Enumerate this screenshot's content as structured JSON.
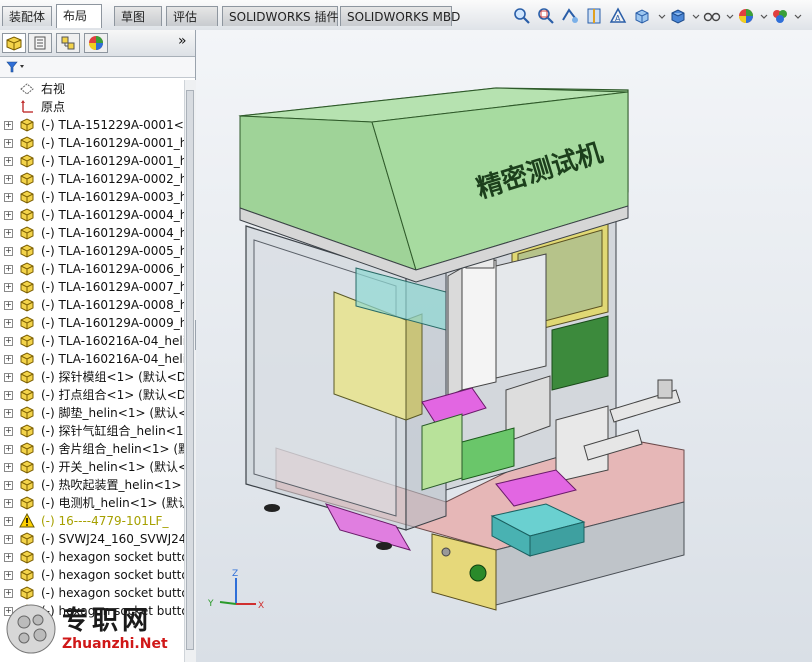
{
  "tabs": [
    "装配体",
    "布局",
    "草图",
    "评估",
    "SOLIDWORKS 插件",
    "SOLIDWORKS MBD"
  ],
  "active_tab": "布局",
  "toolbar_icons": [
    "zoom-to-fit-icon",
    "zoom-area-icon",
    "previous-view-icon",
    "section-view-icon",
    "dynamic-annotation-icon",
    "view-orientation-icon",
    "display-style-icon",
    "hide-show-items-icon",
    "edit-appearance-icon",
    "apply-scene-icon"
  ],
  "panel": {
    "tab_icons": [
      "feature-manager-icon",
      "property-manager-icon",
      "configuration-manager-icon",
      "display-manager-icon"
    ],
    "expand_symbol": "»",
    "filter_icon": "filter-icon"
  },
  "tree": [
    {
      "label": "右视",
      "icon": "plane-icon",
      "expand": false
    },
    {
      "label": "原点",
      "icon": "origin-icon",
      "expand": false
    },
    {
      "label": "(-) TLA-151229A-0001<1",
      "icon": "part-icon",
      "expand": true
    },
    {
      "label": "(-) TLA-160129A-0001_h",
      "icon": "part-icon",
      "expand": true
    },
    {
      "label": "(-) TLA-160129A-0001_h",
      "icon": "part-icon",
      "expand": true
    },
    {
      "label": "(-) TLA-160129A-0002_h",
      "icon": "part-icon",
      "expand": true
    },
    {
      "label": "(-) TLA-160129A-0003_h",
      "icon": "part-icon",
      "expand": true
    },
    {
      "label": "(-) TLA-160129A-0004_h",
      "icon": "part-icon",
      "expand": true
    },
    {
      "label": "(-) TLA-160129A-0004_h",
      "icon": "part-icon",
      "expand": true
    },
    {
      "label": "(-) TLA-160129A-0005_h",
      "icon": "part-icon",
      "expand": true
    },
    {
      "label": "(-) TLA-160129A-0006_h",
      "icon": "part-icon",
      "expand": true
    },
    {
      "label": "(-) TLA-160129A-0007_h",
      "icon": "part-icon",
      "expand": true
    },
    {
      "label": "(-) TLA-160129A-0008_h",
      "icon": "part-icon",
      "expand": true
    },
    {
      "label": "(-) TLA-160129A-0009_h",
      "icon": "part-icon",
      "expand": true
    },
    {
      "label": "(-) TLA-160216A-04_helin",
      "icon": "part-icon",
      "expand": true
    },
    {
      "label": "(-) TLA-160216A-04_helin",
      "icon": "part-icon",
      "expand": true
    },
    {
      "label": "(-) 探针模组<1> (默认<D",
      "icon": "part-icon",
      "expand": true
    },
    {
      "label": "(-) 打点组合<1> (默认<D",
      "icon": "part-icon",
      "expand": true
    },
    {
      "label": "(-) 脚垫_helin<1> (默认<",
      "icon": "part-icon",
      "expand": true
    },
    {
      "label": "(-) 探针气缸组合_helin<1",
      "icon": "part-icon",
      "expand": true
    },
    {
      "label": "(-) 舍片组合_helin<1> (默",
      "icon": "part-icon",
      "expand": true
    },
    {
      "label": "(-) 开关_helin<1> (默认<",
      "icon": "part-icon",
      "expand": true
    },
    {
      "label": "(-) 热吹起装置_helin<1>",
      "icon": "part-icon",
      "expand": true
    },
    {
      "label": "(-) 电测机_helin<1> (默认",
      "icon": "part-icon",
      "expand": true
    },
    {
      "label": "(-) 16----4779-101LF_",
      "icon": "warning-icon",
      "expand": true,
      "warn": true
    },
    {
      "label": "(-) SVWJ24_160_SVWJ24",
      "icon": "part-icon",
      "expand": true
    },
    {
      "label": "(-) hexagon socket butto",
      "icon": "part-icon",
      "expand": true
    },
    {
      "label": "(-) hexagon socket butto",
      "icon": "part-icon",
      "expand": true
    },
    {
      "label": "(-) hexagon socket butto",
      "icon": "part-icon",
      "expand": true
    },
    {
      "label": "(-) hexagon socket butto",
      "icon": "part-icon",
      "expand": true
    }
  ],
  "model": {
    "cover_text": "精密测试机",
    "triad": {
      "x": "X",
      "y": "Y",
      "z": "Z"
    }
  },
  "watermark": {
    "title": "专职网",
    "url": "Zhuanzhi.Net"
  },
  "colors": {
    "cover": "#a6d8a0",
    "base": "#e8b4b4",
    "accent_magenta": "#e060e0",
    "accent_cyan": "#66d6d6",
    "accent_yellow": "#e6d87a"
  }
}
